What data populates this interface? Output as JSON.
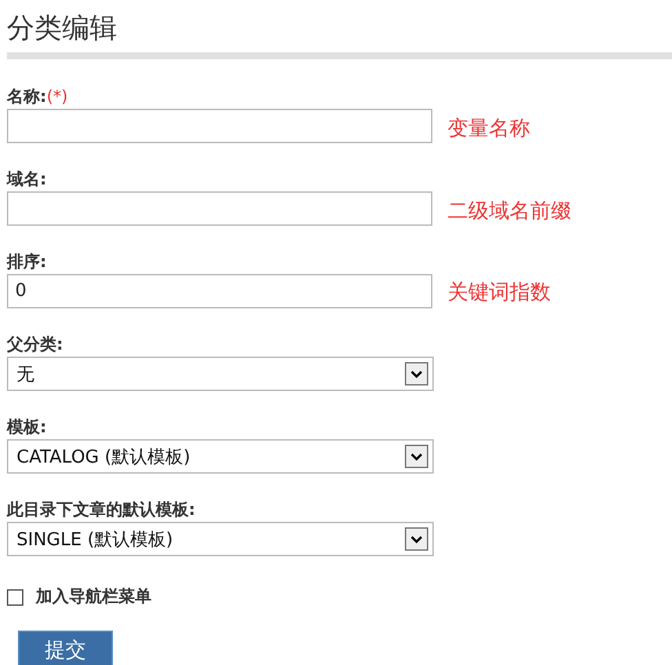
{
  "title": "分类编辑",
  "fields": [
    {
      "kind": "text",
      "label": "名称:",
      "required_mark": "(*)",
      "note": "变量名称"
    },
    {
      "kind": "text",
      "label": "域名:",
      "note": "二级域名前缀"
    },
    {
      "kind": "text",
      "label": "排序:",
      "value": "0",
      "note": "关键词指数"
    },
    {
      "kind": "select",
      "label": "父分类:",
      "value": "无"
    },
    {
      "kind": "select",
      "label": "模板:",
      "value": "CATALOG (默认模板)"
    },
    {
      "kind": "select",
      "label": "此目录下文章的默认模板:",
      "value": "SINGLE (默认模板)"
    }
  ],
  "nav_checkbox": {
    "label": "加入导航栏菜单",
    "checked": false
  },
  "submit": "提交"
}
